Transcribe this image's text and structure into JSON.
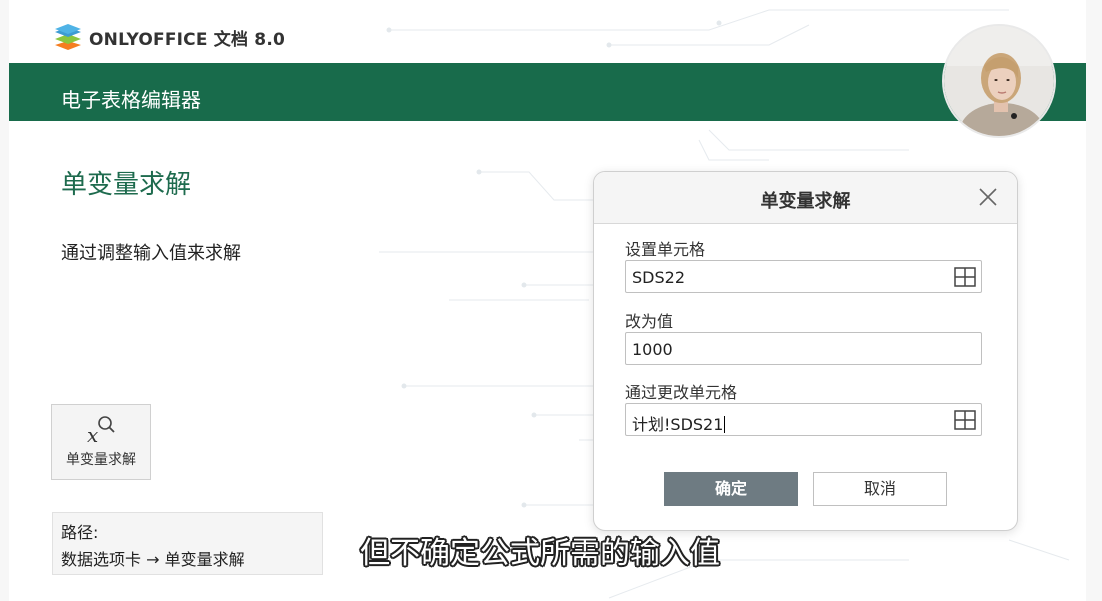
{
  "header": {
    "logo_text": "ONLYOFFICE 文档 8.0",
    "banner_title": "电子表格编辑器",
    "banner_color": "#186b4b"
  },
  "content": {
    "section_title": "单变量求解",
    "section_desc": "通过调整输入值来求解",
    "toolbar_button_label": "单变量求解",
    "path_label": "路径:",
    "path_value": "数据选项卡 → 单变量求解"
  },
  "dialog": {
    "title": "单变量求解",
    "set_cell_label": "设置单元格",
    "set_cell_value": "SDS22",
    "to_value_label": "改为值",
    "to_value_value": "1000",
    "changing_cell_label": "通过更改单元格",
    "changing_cell_value": "计划!SDS21",
    "ok_label": "确定",
    "cancel_label": "取消"
  },
  "subtitle": "但不确定公式所需的输入值",
  "colors": {
    "accent_green": "#1e6b4e",
    "ok_button": "#6e7b82"
  }
}
